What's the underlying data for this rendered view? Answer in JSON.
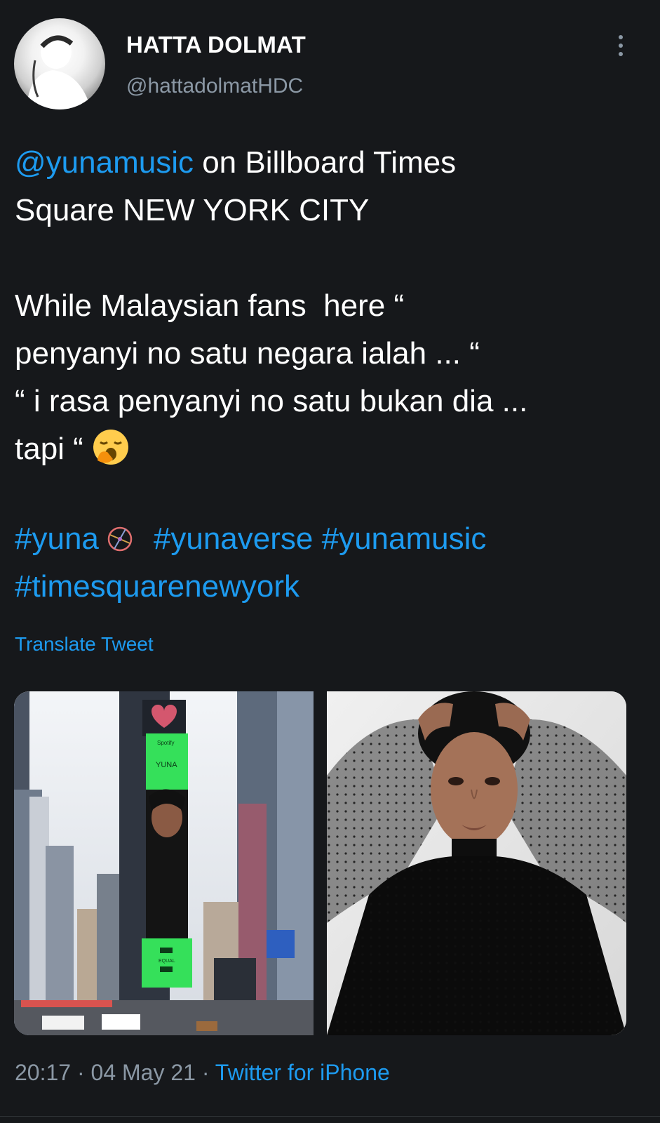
{
  "author": {
    "name": "HATTA DOLMAT",
    "handle": "@hattadolmatHDC"
  },
  "tweet": {
    "mention": "@yunamusic",
    "line1_rest": " on Billboard Times",
    "line2": "Square NEW YORK CITY",
    "line3": "While Malaysian fans  here “",
    "line4": "penyanyi no satu negara ialah ... “",
    "line5": "“ i rasa penyanyi no satu bukan dia ...",
    "line6": "tapi “",
    "hashtag1": "#yuna",
    "hashtag2": "#yunaverse",
    "hashtag3": "#yunamusic",
    "hashtag4": "#timesquarenewyork"
  },
  "translate_label": "Translate Tweet",
  "media": {
    "billboard_brand": "Spotify",
    "billboard_name": "YUNA",
    "billboard_equal": "EQUAL"
  },
  "meta": {
    "time": "20:17",
    "date": "04 May 21",
    "source": "Twitter for iPhone",
    "separator": " · "
  },
  "colors": {
    "background": "#16181b",
    "link": "#1d9bf0",
    "secondary": "#8b98a5"
  },
  "icons": [
    "more-vertical-icon",
    "yawning-face-emoji",
    "satellite-emoji"
  ]
}
